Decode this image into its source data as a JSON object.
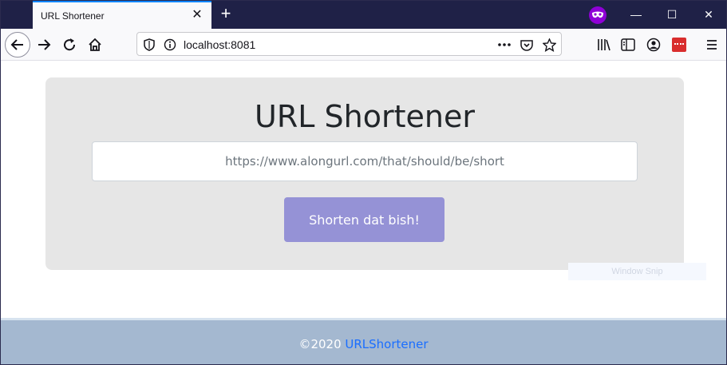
{
  "browser": {
    "tab_title": "URL Shortener",
    "tab_close": "✕",
    "new_tab": "+",
    "url": "localhost:8081",
    "window_controls": {
      "minimize": "—",
      "maximize": "☐",
      "close": "✕"
    },
    "icons": [
      "back-icon",
      "forward-icon",
      "reload-icon",
      "home-icon",
      "tracking-shield-icon",
      "site-info-icon",
      "page-actions-icon",
      "pocket-icon",
      "bookmark-star-icon",
      "library-icon",
      "sidebar-icon",
      "account-icon",
      "extension-icon",
      "menu-icon",
      "private-mask-icon"
    ],
    "accent_color": "#0a84ff",
    "private_color": "#8f00d7"
  },
  "page": {
    "heading": "URL Shortener",
    "input_placeholder": "https://www.alongurl.com/that/should/be/short",
    "input_value": "",
    "button_label": "Shorten dat bish!",
    "button_color": "#9592d6",
    "overlay_text": "Window Snip"
  },
  "footer": {
    "copyright": "©2020 ",
    "link_text": "URLShortener",
    "link_color": "#1a6eff",
    "background": "#a4b8d0"
  }
}
